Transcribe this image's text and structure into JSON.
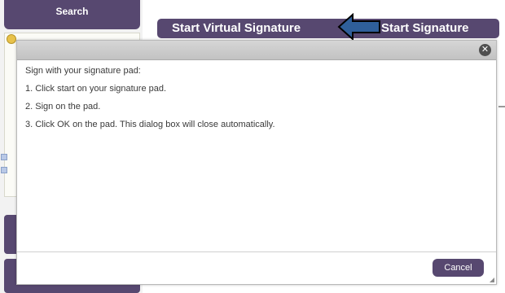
{
  "sidebar": {
    "search_label": "Search"
  },
  "toolbar": {
    "virtual_signature_label": "Start Virtual Signature",
    "start_signature_label": "Start Signature"
  },
  "dialog": {
    "close_icon": "close-icon",
    "lines": [
      "Sign with your signature pad:",
      "1. Click start on your signature pad.",
      "2. Sign on the pad.",
      "3. Click OK on the pad. This dialog box will close automatically."
    ],
    "cancel_label": "Cancel"
  },
  "colors": {
    "brand_purple": "#574870",
    "arrow_fill": "#2f5f9a",
    "titlebar_gray": "#c9c9c9"
  }
}
